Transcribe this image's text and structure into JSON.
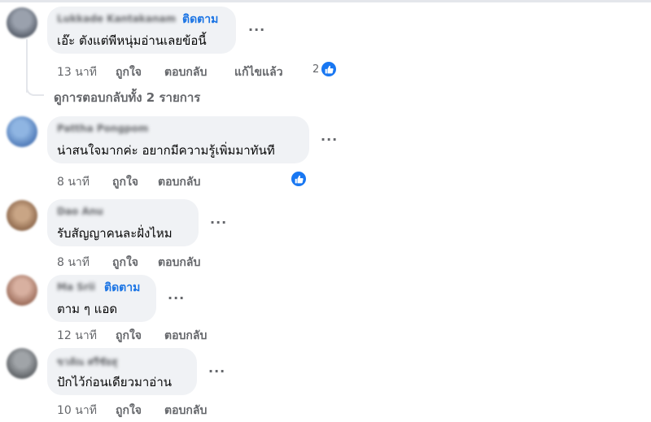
{
  "comments": [
    {
      "author": "Lukkade Kantakanam",
      "follow": "ติดตาม",
      "text": "เอ๊ะ ตังแต่พีหนุ่มอ่านเลยข้อนี้",
      "time": "13 นาที",
      "like": "ถูกใจ",
      "reply": "ตอบกลับ",
      "edited": "แก้ไขแล้ว",
      "reactions": "2",
      "avatar_color": "#6f7785"
    },
    {
      "author": "Pattha Pongpom",
      "text": "น่าสนใจมากค่ะ อยากมีความรู้เพิ่มมาทันที",
      "time": "8 นาที",
      "like": "ถูกใจ",
      "reply": "ตอบกลับ",
      "avatar_color": "#5b88c4"
    },
    {
      "author": "Dao Anu",
      "text": "รับสัญญาคนละฝั่งไหม",
      "time": "8 นาที",
      "like": "ถูกใจ",
      "reply": "ตอบกลับ",
      "avatar_color": "#b08c6c"
    },
    {
      "author": "Ma Srii",
      "follow": "ติดตาม",
      "text": "ตาม ๆ แอด",
      "time": "12 นาที",
      "like": "ถูกใจ",
      "reply": "ตอบกลับ",
      "avatar_color": "#b67f6e"
    },
    {
      "author": "ขวลัณ ศรีชัยสุ",
      "text": "ปักไว้ก่อนเดียวมาอ่าน",
      "time": "10 นาที",
      "like": "ถูกใจ",
      "reply": "ตอบกลับ",
      "avatar_color": "#7a7e82"
    }
  ],
  "view_replies": "ดูการตอบกลับทั้ง 2 รายการ",
  "more_label": "...",
  "colors": {
    "accent": "#1877f2",
    "bubble": "#f0f2f5",
    "meta": "#65676b"
  },
  "icons": {
    "like": "thumbs-up-icon",
    "more": "more-horizontal-icon"
  }
}
